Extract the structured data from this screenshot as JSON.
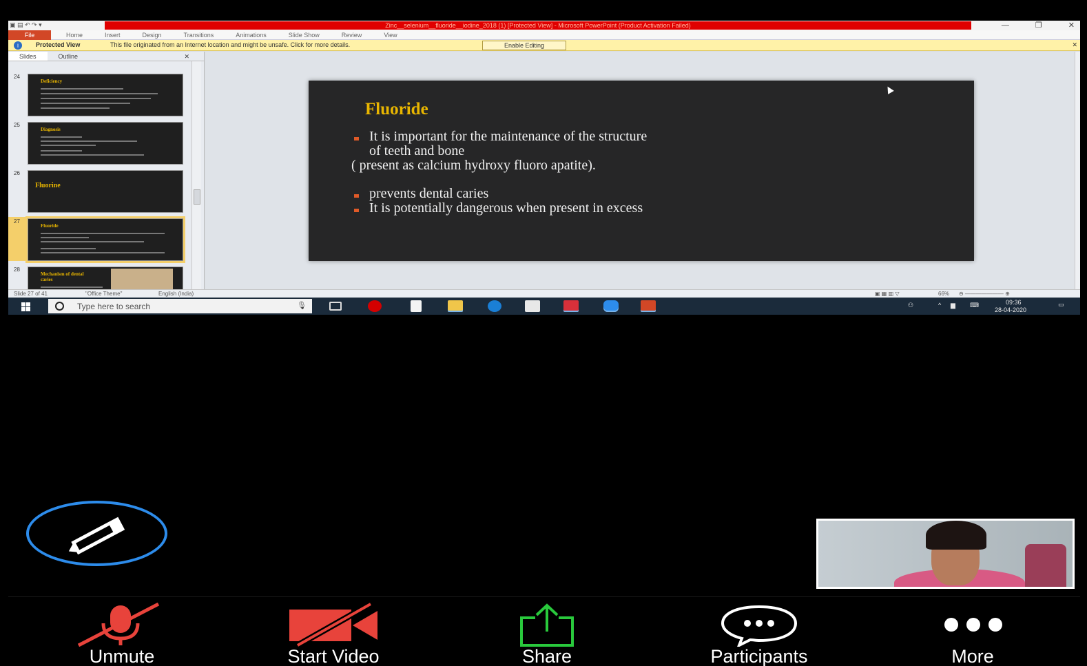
{
  "powerpoint": {
    "title": "Zinc__selenium__fluoride__iodine_2018 (1) [Protected View] - Microsoft PowerPoint (Product Activation Failed)",
    "ribbon_tabs": [
      "File",
      "Home",
      "Insert",
      "Design",
      "Transitions",
      "Animations",
      "Slide Show",
      "Review",
      "View"
    ],
    "protected": {
      "label": "Protected View",
      "message": "This file originated from an Internet location and might be unsafe. Click for more details.",
      "button": "Enable Editing"
    },
    "pane_tabs": [
      "Slides",
      "Outline"
    ],
    "thumbnails": [
      {
        "number": "24",
        "title": "Deficiency"
      },
      {
        "number": "25",
        "title": "Diagnosis"
      },
      {
        "number": "26",
        "title": "Fluorine"
      },
      {
        "number": "27",
        "title": "Fluoride"
      },
      {
        "number": "28",
        "title": "Mechanism of dental caries"
      }
    ],
    "slide": {
      "title": "Fluoride",
      "lines": [
        "It is important for the maintenance of the structure",
        "of teeth and bone",
        "( present as calcium hydroxy fluoro apatite).",
        "prevents dental caries",
        "It is potentially dangerous when present in excess"
      ]
    },
    "status": {
      "slide": "Slide 27 of 41",
      "theme": "\"Office Theme\"",
      "language": "English (India)",
      "zoom": "66%"
    }
  },
  "taskbar": {
    "search_placeholder": "Type here to search",
    "time": "09:36",
    "date": "28-04-2020"
  },
  "zoom": {
    "buttons": [
      {
        "label": "Unmute"
      },
      {
        "label": "Start Video"
      },
      {
        "label": "Share"
      },
      {
        "label": "Participants"
      },
      {
        "label": "More"
      }
    ]
  },
  "colors": {
    "annotate_ring": "#2d8ceb",
    "muted_red": "#e8433b",
    "share_green": "#29c93c",
    "slide_title": "#e9b600",
    "bullet": "#e05a28"
  }
}
